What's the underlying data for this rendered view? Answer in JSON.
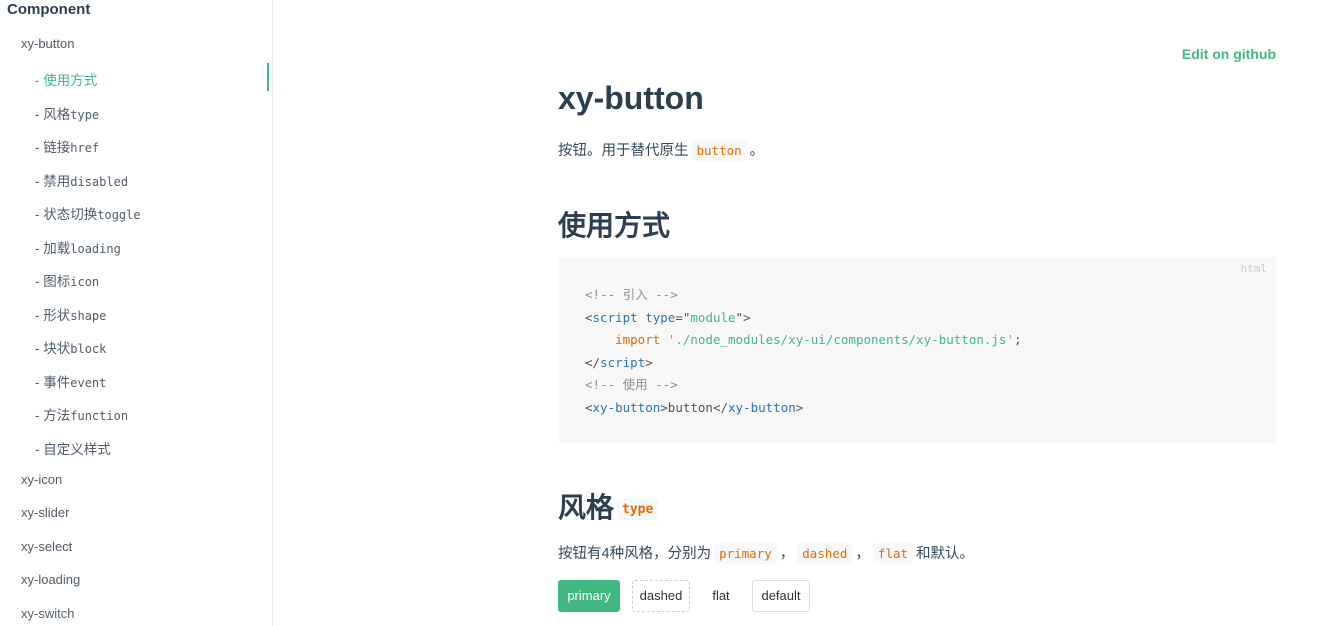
{
  "sidebar": {
    "heading": "Component",
    "items": [
      {
        "label": "xy-button",
        "level": "top",
        "active": false
      },
      {
        "label": "- 使用方式",
        "level": "sub",
        "active": true
      },
      {
        "label": "- 风格",
        "code": "type",
        "level": "sub",
        "active": false
      },
      {
        "label": "- 链接",
        "code": "href",
        "level": "sub",
        "active": false
      },
      {
        "label": "- 禁用",
        "code": "disabled",
        "level": "sub",
        "active": false
      },
      {
        "label": "- 状态切换",
        "code": "toggle",
        "level": "sub",
        "active": false
      },
      {
        "label": "- 加载",
        "code": "loading",
        "level": "sub",
        "active": false
      },
      {
        "label": "- 图标",
        "code": "icon",
        "level": "sub",
        "active": false
      },
      {
        "label": "- 形状",
        "code": "shape",
        "level": "sub",
        "active": false
      },
      {
        "label": "- 块状",
        "code": "block",
        "level": "sub",
        "active": false
      },
      {
        "label": "- 事件",
        "code": "event",
        "level": "sub",
        "active": false
      },
      {
        "label": "- 方法",
        "code": "function",
        "level": "sub",
        "active": false
      },
      {
        "label": "- 自定义样式",
        "level": "sub",
        "active": false
      },
      {
        "label": "xy-icon",
        "level": "top",
        "active": false
      },
      {
        "label": "xy-slider",
        "level": "top",
        "active": false
      },
      {
        "label": "xy-select",
        "level": "top",
        "active": false
      },
      {
        "label": "xy-loading",
        "level": "top",
        "active": false
      },
      {
        "label": "xy-switch",
        "level": "top",
        "active": false
      }
    ]
  },
  "content": {
    "edit_link": "Edit on github",
    "title": "xy-button",
    "intro": {
      "before": "按钮。用于替代原生",
      "code": "button",
      "after": "。"
    },
    "section_usage": "使用方式",
    "code_block": {
      "lang": "html",
      "lines": {
        "l1": "<!-- 引入 -->",
        "l2_open": "<",
        "l2_tag": "script",
        "l2_attr": "type",
        "l2_eq": "=\"",
        "l2_val": "module",
        "l2_close": "\">",
        "l3_kw": "import",
        "l3_str": "'./node_modules/xy-ui/components/xy-button.js'",
        "l3_end": ";",
        "l4_open": "</",
        "l4_tag": "script",
        "l4_close": ">",
        "l5": "<!-- 使用 -->",
        "l6_open": "<",
        "l6_tag": "xy-button",
        "l6_mid1": ">",
        "l6_text": "button",
        "l6_mid2": "</",
        "l6_tag2": "xy-button",
        "l6_close": ">"
      }
    },
    "section_style": {
      "label": "风格",
      "code": "type"
    },
    "style_desc": {
      "before": "按钮有4种风格，分别为",
      "code1": "primary",
      "sep1": "，",
      "code2": "dashed",
      "sep2": "，",
      "code3": "flat",
      "after": "和默认。"
    },
    "buttons": {
      "primary": "primary",
      "dashed": "dashed",
      "flat": "flat",
      "default": "default"
    }
  },
  "colors": {
    "accent": "#42b983",
    "code_orange": "#e96900",
    "text": "#34495e"
  }
}
